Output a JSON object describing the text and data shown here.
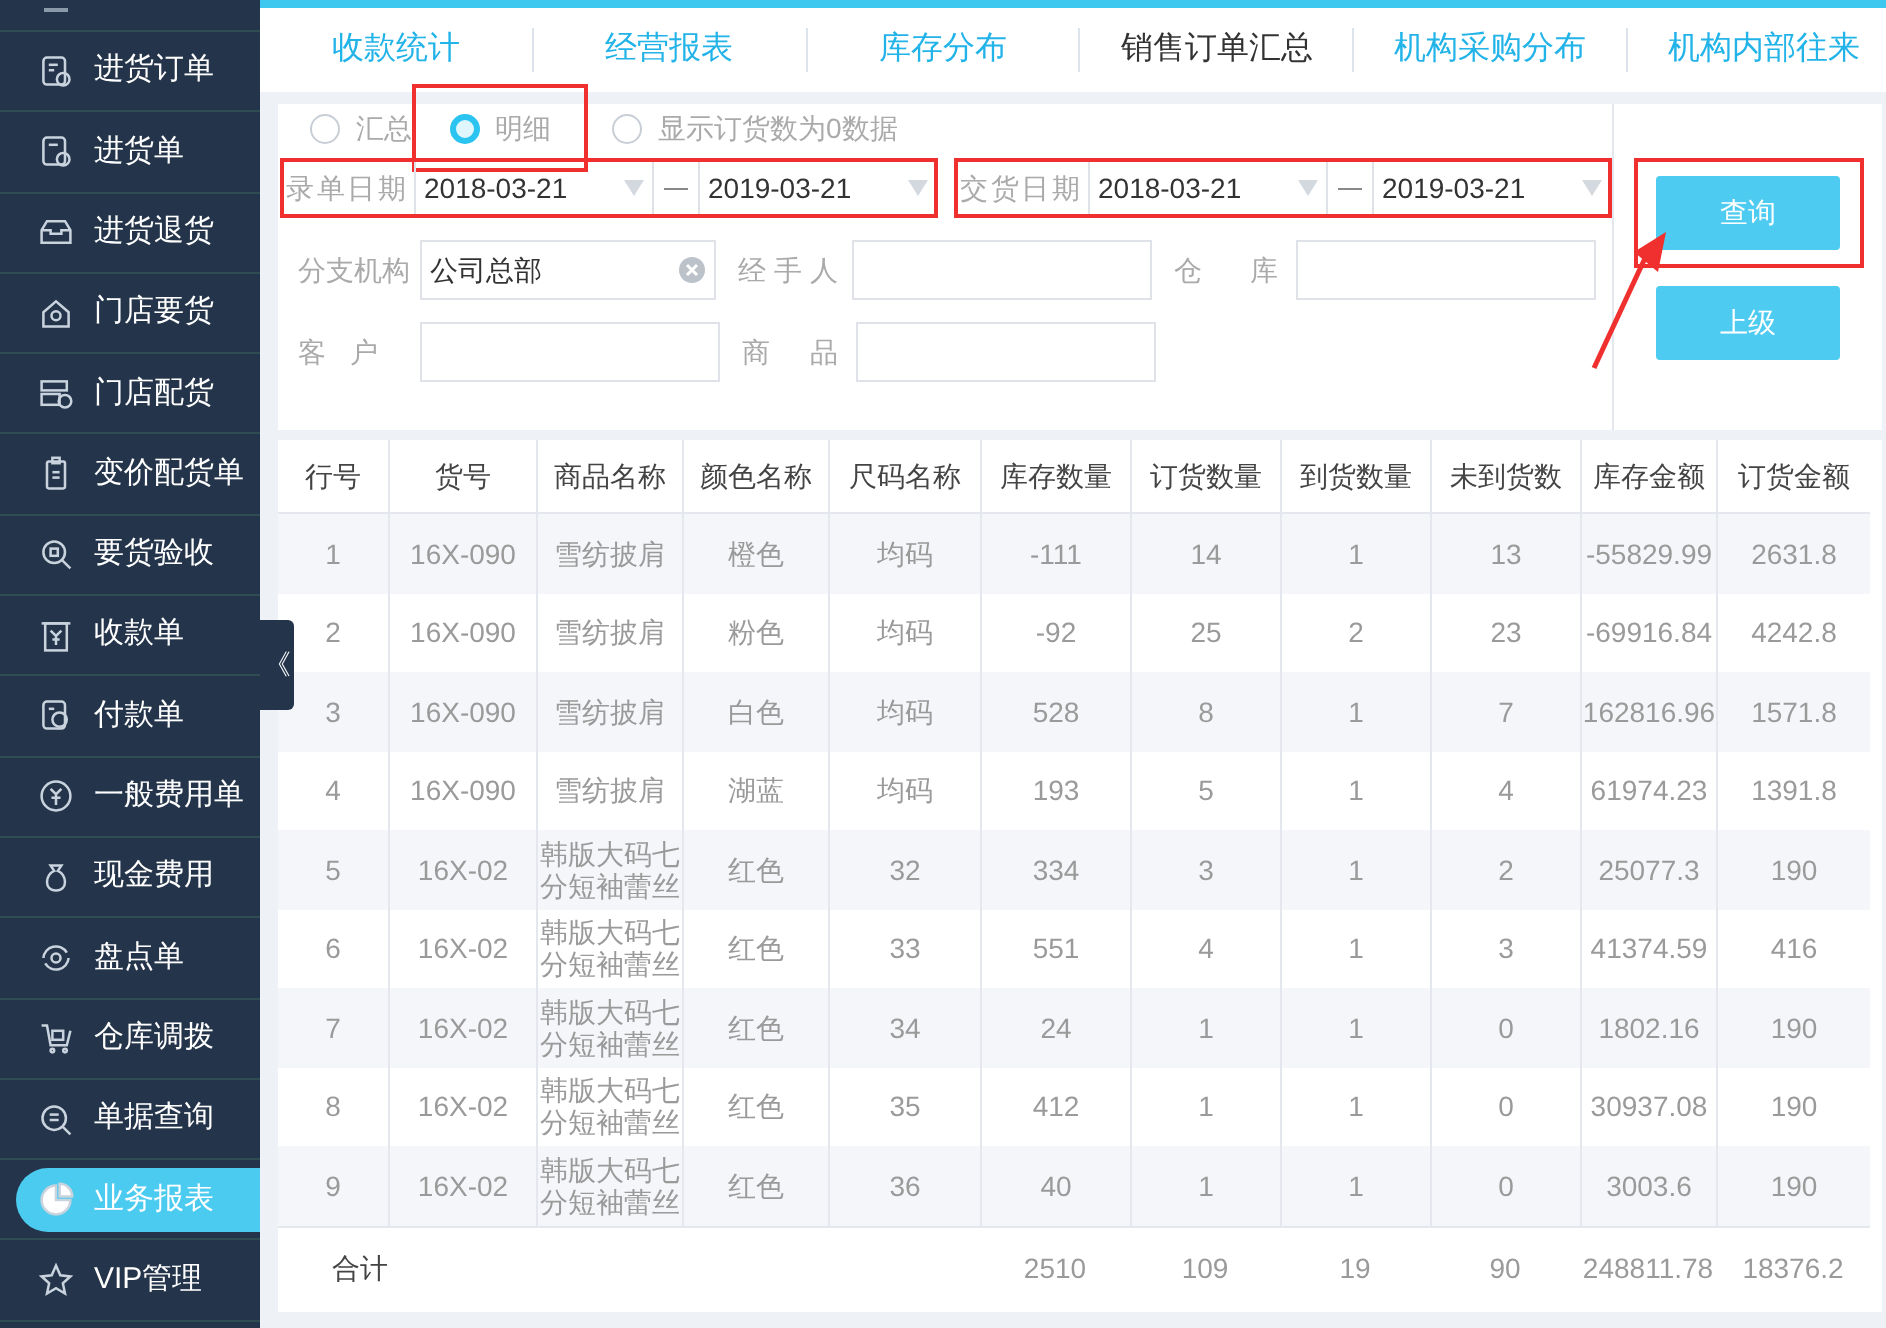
{
  "sidebar": {
    "items": [
      {
        "label": "进货订单",
        "selected": false
      },
      {
        "label": "进货单",
        "selected": false
      },
      {
        "label": "进货退货",
        "selected": false
      },
      {
        "label": "门店要货",
        "selected": false
      },
      {
        "label": "门店配货",
        "selected": false
      },
      {
        "label": "变价配货单",
        "selected": false
      },
      {
        "label": "要货验收",
        "selected": false
      },
      {
        "label": "收款单",
        "selected": false
      },
      {
        "label": "付款单",
        "selected": false
      },
      {
        "label": "一般费用单",
        "selected": false
      },
      {
        "label": "现金费用",
        "selected": false
      },
      {
        "label": "盘点单",
        "selected": false
      },
      {
        "label": "仓库调拨",
        "selected": false
      },
      {
        "label": "单据查询",
        "selected": false
      },
      {
        "label": "业务报表",
        "selected": true
      },
      {
        "label": "VIP管理",
        "selected": false
      }
    ]
  },
  "collapse_toggle": "《",
  "tabs": [
    {
      "label": "收款统计",
      "selected": false
    },
    {
      "label": "经营报表",
      "selected": false
    },
    {
      "label": "库存分布",
      "selected": false
    },
    {
      "label": "销售订单汇总",
      "selected": true
    },
    {
      "label": "机构采购分布",
      "selected": false
    },
    {
      "label": "机构内部往来",
      "selected": false
    }
  ],
  "filters": {
    "mode": [
      {
        "label": "汇总",
        "checked": false,
        "highlighted": false
      },
      {
        "label": "明细",
        "checked": true,
        "highlighted": true
      }
    ],
    "show_zero": {
      "label": "显示订货数为0数据",
      "checked": false
    },
    "entry_date": {
      "label": "录单日期",
      "from": "2018-03-21",
      "to": "2019-03-21",
      "highlighted": true
    },
    "delivery_date": {
      "label": "交货日期",
      "from": "2018-03-21",
      "to": "2019-03-21",
      "highlighted": true
    },
    "branch": {
      "label": "分支机构",
      "value": "公司总部"
    },
    "handler": {
      "label": "经 手 人"
    },
    "warehouse": {
      "label": "仓 库"
    },
    "customer": {
      "label": "客 户"
    },
    "product": {
      "label": "商 品"
    },
    "buttons": [
      {
        "label": "查询",
        "highlighted": true
      },
      {
        "label": "上级",
        "highlighted": false
      }
    ]
  },
  "table": {
    "columns": [
      "行号",
      "货号",
      "商品名称",
      "颜色名称",
      "尺码名称",
      "库存数量",
      "订货数量",
      "到货数量",
      "未到货数",
      "库存金额",
      "订货金额"
    ],
    "rows": [
      [
        "1",
        "16X-090",
        "雪纺披肩",
        "橙色",
        "均码",
        "-111",
        "14",
        "1",
        "13",
        "-55829.99",
        "2631.8"
      ],
      [
        "2",
        "16X-090",
        "雪纺披肩",
        "粉色",
        "均码",
        "-92",
        "25",
        "2",
        "23",
        "-69916.84",
        "4242.8"
      ],
      [
        "3",
        "16X-090",
        "雪纺披肩",
        "白色",
        "均码",
        "528",
        "8",
        "1",
        "7",
        "162816.96",
        "1571.8"
      ],
      [
        "4",
        "16X-090",
        "雪纺披肩",
        "湖蓝",
        "均码",
        "193",
        "5",
        "1",
        "4",
        "61974.23",
        "1391.8"
      ],
      [
        "5",
        "16X-02",
        "韩版大码七分短袖蕾丝",
        "红色",
        "32",
        "334",
        "3",
        "1",
        "2",
        "25077.3",
        "190"
      ],
      [
        "6",
        "16X-02",
        "韩版大码七分短袖蕾丝",
        "红色",
        "33",
        "551",
        "4",
        "1",
        "3",
        "41374.59",
        "416"
      ],
      [
        "7",
        "16X-02",
        "韩版大码七分短袖蕾丝",
        "红色",
        "34",
        "24",
        "1",
        "1",
        "0",
        "1802.16",
        "190"
      ],
      [
        "8",
        "16X-02",
        "韩版大码七分短袖蕾丝",
        "红色",
        "35",
        "412",
        "1",
        "1",
        "0",
        "30937.08",
        "190"
      ],
      [
        "9",
        "16X-02",
        "韩版大码七分短袖蕾丝",
        "红色",
        "36",
        "40",
        "1",
        "1",
        "0",
        "3003.6",
        "190"
      ]
    ],
    "footer": {
      "label": "合计",
      "values": [
        "2510",
        "109",
        "19",
        "90",
        "248811.78",
        "18376.2"
      ]
    }
  }
}
